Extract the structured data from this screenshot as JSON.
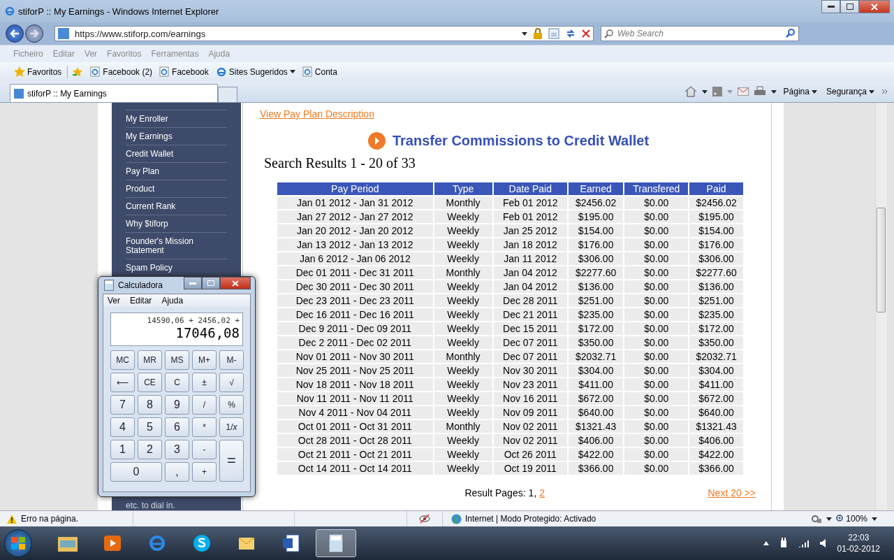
{
  "window": {
    "title": "stiforP :: My Earnings - Windows Internet Explorer"
  },
  "address_bar": {
    "url": "https://www.stiforp.com/earnings",
    "search_placeholder": "Web Search"
  },
  "menu": [
    "Ficheiro",
    "Editar",
    "Ver",
    "Favoritos",
    "Ferramentas",
    "Ajuda"
  ],
  "favorites": [
    {
      "label": "Favoritos",
      "kind": "star"
    },
    {
      "label": "Facebook (2)",
      "kind": "page"
    },
    {
      "label": "Facebook",
      "kind": "page"
    },
    {
      "label": "Sites Sugeridos",
      "kind": "dropdown"
    },
    {
      "label": "Conta",
      "kind": "page"
    }
  ],
  "tabs": [
    {
      "label": "stiforP :: My Earnings",
      "selected": true
    }
  ],
  "command_bar": [
    "Página",
    "Segurança"
  ],
  "sidebar": {
    "items": [
      {
        "label": "My Enroller"
      },
      {
        "label": "My Earnings"
      },
      {
        "label": "Credit Wallet"
      },
      {
        "label": "Pay Plan"
      },
      {
        "label": "Product"
      },
      {
        "label": "Current Rank"
      },
      {
        "label": "Why $tiforp"
      },
      {
        "label": "Founder's Mission Statement"
      },
      {
        "label": "Spam Policy"
      }
    ],
    "note": "etc. to dial in."
  },
  "page": {
    "link": "View Pay Plan Description",
    "heading": "Transfer Commissions to Credit Wallet",
    "summary": "Search Results 1 - 20 of 33",
    "table": {
      "columns": [
        "Pay Period",
        "Type",
        "Date Paid",
        "Earned",
        "Transfered",
        "Paid"
      ],
      "rows": [
        [
          "Jan 01 2012 - Jan 31 2012",
          "Monthly",
          "Feb 01 2012",
          "$2456.02",
          "$0.00",
          "$2456.02"
        ],
        [
          "Jan 27 2012 - Jan 27 2012",
          "Weekly",
          "Feb 01 2012",
          "$195.00",
          "$0.00",
          "$195.00"
        ],
        [
          "Jan 20 2012 - Jan 20 2012",
          "Weekly",
          "Jan 25 2012",
          "$154.00",
          "$0.00",
          "$154.00"
        ],
        [
          "Jan 13 2012 - Jan 13 2012",
          "Weekly",
          "Jan 18 2012",
          "$176.00",
          "$0.00",
          "$176.00"
        ],
        [
          "Jan 6 2012 - Jan 06 2012",
          "Weekly",
          "Jan 11 2012",
          "$306.00",
          "$0.00",
          "$306.00"
        ],
        [
          "Dec 01 2011 - Dec 31 2011",
          "Monthly",
          "Jan 04 2012",
          "$2277.60",
          "$0.00",
          "$2277.60"
        ],
        [
          "Dec 30 2011 - Dec 30 2011",
          "Weekly",
          "Jan 04 2012",
          "$136.00",
          "$0.00",
          "$136.00"
        ],
        [
          "Dec 23 2011 - Dec 23 2011",
          "Weekly",
          "Dec 28 2011",
          "$251.00",
          "$0.00",
          "$251.00"
        ],
        [
          "Dec 16 2011 - Dec 16 2011",
          "Weekly",
          "Dec 21 2011",
          "$235.00",
          "$0.00",
          "$235.00"
        ],
        [
          "Dec 9 2011 - Dec 09 2011",
          "Weekly",
          "Dec 15 2011",
          "$172.00",
          "$0.00",
          "$172.00"
        ],
        [
          "Dec 2 2011 - Dec 02 2011",
          "Weekly",
          "Dec 07 2011",
          "$350.00",
          "$0.00",
          "$350.00"
        ],
        [
          "Nov 01 2011 - Nov 30 2011",
          "Monthly",
          "Dec 07 2011",
          "$2032.71",
          "$0.00",
          "$2032.71"
        ],
        [
          "Nov 25 2011 - Nov 25 2011",
          "Weekly",
          "Nov 30 2011",
          "$304.00",
          "$0.00",
          "$304.00"
        ],
        [
          "Nov 18 2011 - Nov 18 2011",
          "Weekly",
          "Nov 23 2011",
          "$411.00",
          "$0.00",
          "$411.00"
        ],
        [
          "Nov 11 2011 - Nov 11 2011",
          "Weekly",
          "Nov 16 2011",
          "$672.00",
          "$0.00",
          "$672.00"
        ],
        [
          "Nov 4 2011 - Nov 04 2011",
          "Weekly",
          "Nov 09 2011",
          "$640.00",
          "$0.00",
          "$640.00"
        ],
        [
          "Oct 01 2011 - Oct 31 2011",
          "Monthly",
          "Nov 02 2011",
          "$1321.43",
          "$0.00",
          "$1321.43"
        ],
        [
          "Oct 28 2011 - Oct 28 2011",
          "Weekly",
          "Nov 02 2011",
          "$406.00",
          "$0.00",
          "$406.00"
        ],
        [
          "Oct 21 2011 - Oct 21 2011",
          "Weekly",
          "Oct 26 2011",
          "$422.00",
          "$0.00",
          "$422.00"
        ],
        [
          "Oct 14 2011 - Oct 14 2011",
          "Weekly",
          "Oct 19 2011",
          "$366.00",
          "$0.00",
          "$366.00"
        ]
      ]
    },
    "pagination": {
      "label": "Result Pages:",
      "pages": [
        {
          "label": "1,",
          "selected": true
        },
        {
          "label": "2",
          "selected": false
        }
      ],
      "next": "Next 20 >>"
    }
  },
  "calculator": {
    "title": "Calculadora",
    "menu": [
      "Ver",
      "Editar",
      "Ajuda"
    ],
    "expression": "14590,06 + 2456,02 +",
    "display": "17046,08",
    "keys": [
      {
        "label": "MC",
        "kind": "mem"
      },
      {
        "label": "MR",
        "kind": "mem"
      },
      {
        "label": "MS",
        "kind": "mem"
      },
      {
        "label": "M+",
        "kind": "mem"
      },
      {
        "label": "M-",
        "kind": "mem"
      },
      {
        "label": "⟵",
        "kind": "op"
      },
      {
        "label": "CE",
        "kind": "op"
      },
      {
        "label": "C",
        "kind": "op"
      },
      {
        "label": "±",
        "kind": "op"
      },
      {
        "label": "√",
        "kind": "op"
      },
      {
        "label": "7",
        "kind": "digit"
      },
      {
        "label": "8",
        "kind": "digit"
      },
      {
        "label": "9",
        "kind": "digit"
      },
      {
        "label": "/",
        "kind": "op"
      },
      {
        "label": "%",
        "kind": "op"
      },
      {
        "label": "4",
        "kind": "digit"
      },
      {
        "label": "5",
        "kind": "digit"
      },
      {
        "label": "6",
        "kind": "digit"
      },
      {
        "label": "*",
        "kind": "op"
      },
      {
        "label": "1/*x*",
        "kind": "op"
      },
      {
        "label": "1",
        "kind": "digit"
      },
      {
        "label": "2",
        "kind": "digit"
      },
      {
        "label": "3",
        "kind": "digit"
      },
      {
        "label": "-",
        "kind": "op"
      },
      {
        "label": "=",
        "kind": "tall"
      },
      {
        "label": "0",
        "kind": "wide"
      },
      {
        "label": ",",
        "kind": "digit"
      },
      {
        "label": "+",
        "kind": "op"
      }
    ]
  },
  "status_bar": {
    "message": "Erro na página.",
    "zone": "Internet | Modo Protegido: Activado",
    "zoom": "100%"
  },
  "taskbar": {
    "apps": [
      {
        "kind": "folder",
        "selected": false
      },
      {
        "kind": "media",
        "selected": false
      },
      {
        "kind": "ie",
        "selected": false
      },
      {
        "kind": "skype",
        "selected": false
      },
      {
        "kind": "mail",
        "selected": false
      },
      {
        "kind": "word",
        "selected": false
      },
      {
        "kind": "calc",
        "selected": true
      }
    ],
    "time": "22:03",
    "date": "01-02-2012"
  }
}
